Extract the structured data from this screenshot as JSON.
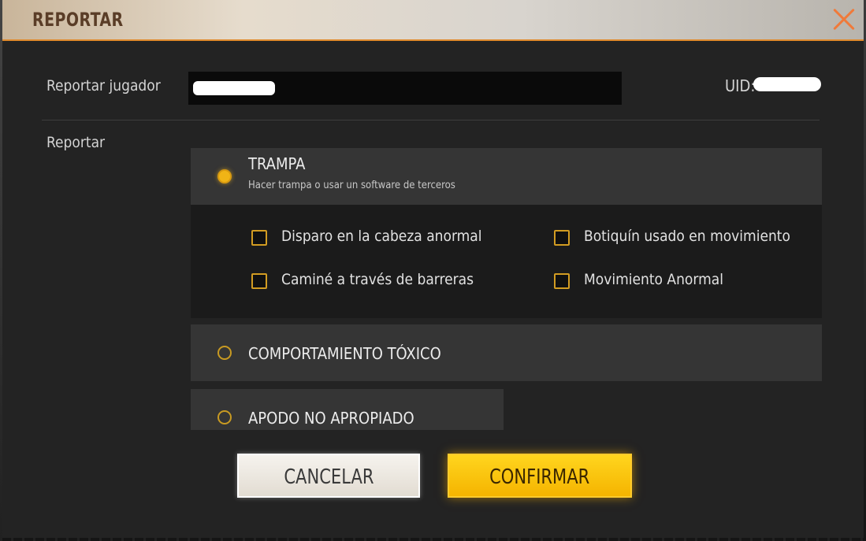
{
  "dialog": {
    "title": "REPORTAR",
    "close_icon": "close-x-icon",
    "accent_color": "#f0b416"
  },
  "player": {
    "label": "Reportar jugador",
    "uid_label": "UID:"
  },
  "report_section": {
    "label": "Reportar"
  },
  "options": [
    {
      "title": "TRAMPA",
      "description": "Hacer trampa o usar un software de terceros",
      "selected": true,
      "sub_options": [
        "Disparo en la cabeza anormal",
        "Botiquín usado en movimiento",
        "Caminé a través de barreras",
        "Movimiento Anormal"
      ]
    },
    {
      "title": "COMPORTAMIENTO TÓXICO",
      "selected": false
    },
    {
      "title": "APODO NO APROPIADO",
      "selected": false
    }
  ],
  "buttons": {
    "cancel": "CANCELAR",
    "confirm": "CONFIRMAR"
  }
}
